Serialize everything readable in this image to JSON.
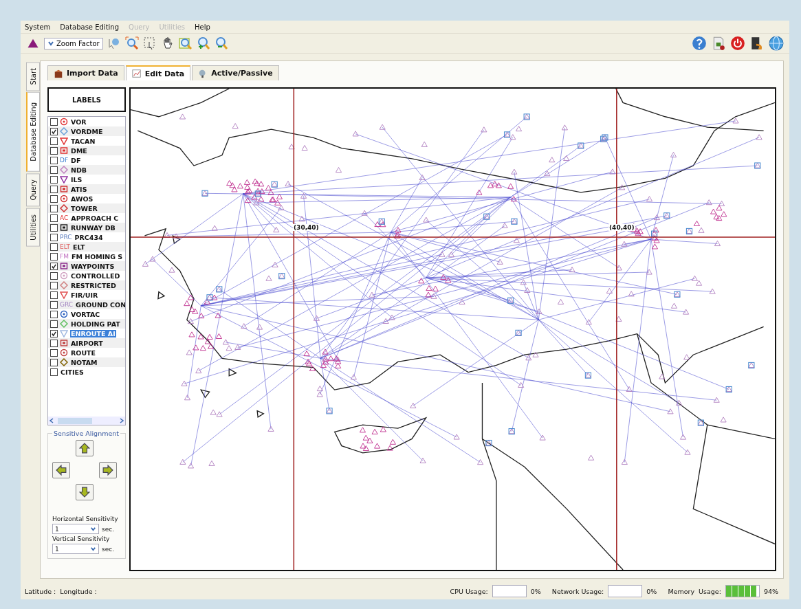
{
  "menu": [
    {
      "label": "System",
      "disabled": false
    },
    {
      "label": "Database Editing",
      "disabled": false
    },
    {
      "label": "Query",
      "disabled": true
    },
    {
      "label": "Utilities",
      "disabled": true
    },
    {
      "label": "Help",
      "disabled": false
    }
  ],
  "toolbar": {
    "zoom_dropdown": "Zoom Factor"
  },
  "side_tabs": [
    {
      "label": "Start",
      "selected": false
    },
    {
      "label": "Database Editing",
      "selected": true
    },
    {
      "label": "Query",
      "selected": false
    },
    {
      "label": "Utilities",
      "selected": false
    }
  ],
  "tabs": [
    {
      "label": "Import Data",
      "selected": false
    },
    {
      "label": "Edit Data",
      "selected": true
    },
    {
      "label": "Active/Passive",
      "selected": false
    }
  ],
  "labels_button": "LABELS",
  "layers": [
    {
      "label": "VOR",
      "checked": false,
      "selected": false
    },
    {
      "label": "VORDME",
      "checked": true,
      "selected": false
    },
    {
      "label": "TACAN",
      "checked": false,
      "selected": false
    },
    {
      "label": "DME",
      "checked": false,
      "selected": false
    },
    {
      "label": "DF",
      "badge": "DF",
      "checked": false,
      "selected": false
    },
    {
      "label": "NDB",
      "checked": false,
      "selected": false
    },
    {
      "label": "ILS",
      "checked": false,
      "selected": false
    },
    {
      "label": "ATIS",
      "checked": false,
      "selected": false
    },
    {
      "label": "AWOS",
      "checked": false,
      "selected": false
    },
    {
      "label": "TOWER",
      "checked": false,
      "selected": false
    },
    {
      "label": "APPROACH C",
      "badge": "AC",
      "checked": false,
      "selected": false
    },
    {
      "label": "RUNWAY DB",
      "checked": false,
      "selected": false
    },
    {
      "label": "PRC434",
      "badge": "PRC",
      "checked": false,
      "selected": false
    },
    {
      "label": "ELT",
      "badge": "ELT",
      "checked": false,
      "selected": false
    },
    {
      "label": "FM HOMING S",
      "badge": "FM",
      "checked": false,
      "selected": false
    },
    {
      "label": "WAYPOINTS",
      "checked": true,
      "selected": false
    },
    {
      "label": "CONTROLLED",
      "checked": false,
      "selected": false
    },
    {
      "label": "RESTRICTED",
      "checked": false,
      "selected": false
    },
    {
      "label": "FIR/UIR",
      "checked": false,
      "selected": false
    },
    {
      "label": "GROUND CON",
      "badge": "GRC",
      "checked": false,
      "selected": false
    },
    {
      "label": "VORTAC",
      "checked": false,
      "selected": false
    },
    {
      "label": "HOLDING PAT",
      "checked": false,
      "selected": false
    },
    {
      "label": "ENROUTE AI",
      "checked": true,
      "selected": true
    },
    {
      "label": "AIRPORT",
      "checked": false,
      "selected": false
    },
    {
      "label": "ROUTE",
      "checked": false,
      "selected": false
    },
    {
      "label": "NOTAM",
      "checked": false,
      "selected": false
    },
    {
      "label": "CITIES",
      "checked": false,
      "selected": false
    }
  ],
  "alignment": {
    "title": "Sensitive Alignment",
    "horizontal_label": "Horizontal Sensitivity",
    "horizontal_value": "1",
    "horizontal_unit": "sec.",
    "vertical_label": "Vertical Sensitivity",
    "vertical_value": "1",
    "vertical_unit": "sec."
  },
  "map": {
    "grid_labels": [
      "(30,40)",
      "(40,40)"
    ]
  },
  "status_bar": {
    "latitude": "Latitude :",
    "longitude": "Longitude :",
    "cpu_label": "CPU Usage:",
    "cpu_value": "0%",
    "network_label": "Network Usage:",
    "network_value": "0%",
    "memory_label": "Memory  Usage:",
    "memory_meter": {
      "level": 0.94
    },
    "memory_value": "94%"
  }
}
